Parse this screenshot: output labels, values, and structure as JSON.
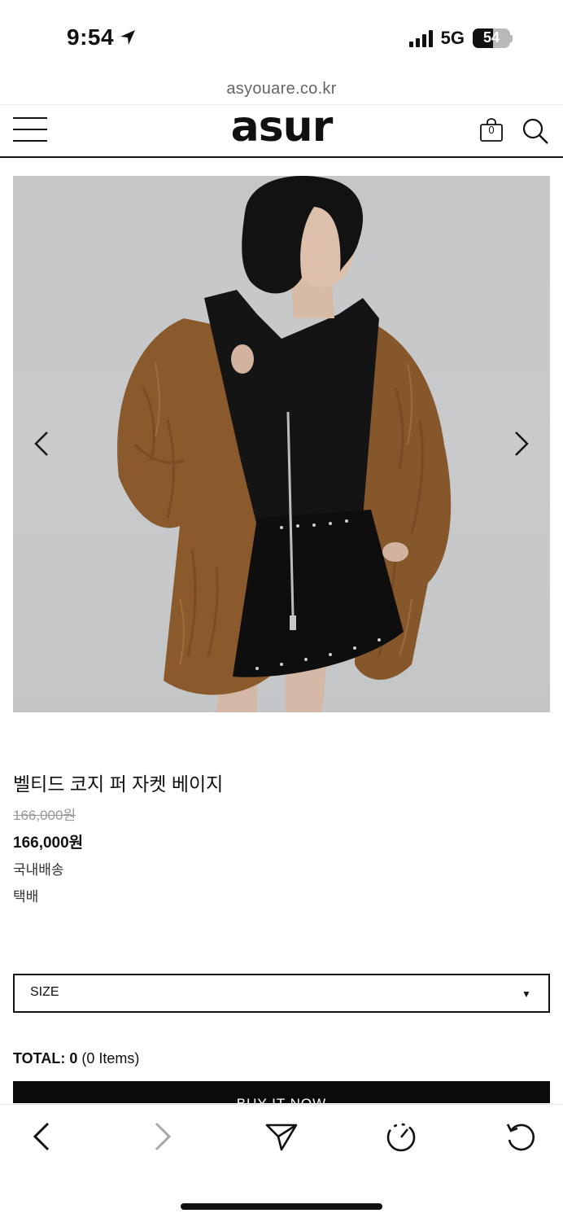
{
  "status_bar": {
    "time": "9:54",
    "network": "5G",
    "battery": "54",
    "battery_level": 0.54
  },
  "browser": {
    "url": "asyouare.co.kr"
  },
  "header": {
    "logo": "asur",
    "cart_count": "0",
    "icons": [
      "menu-icon",
      "shopping-bag-icon",
      "search-icon"
    ]
  },
  "gallery": {
    "prev_icon": "chevron-left-icon",
    "next_icon": "chevron-right-icon"
  },
  "product": {
    "title": "벨티드 코지 퍼 자켓 베이지",
    "original_price": "166,000원",
    "price": "166,000원",
    "shipping_region": "국내배송",
    "shipping_method": "택배"
  },
  "options": {
    "size_label": "SIZE"
  },
  "total": {
    "label": "TOTAL:",
    "amount": "0",
    "items": "(0 Items)"
  },
  "actions": {
    "buy_now": "BUY IT NOW"
  },
  "toolbar": {
    "icons": [
      "back-icon",
      "forward-icon",
      "share-icon",
      "speed-icon",
      "reload-icon"
    ]
  },
  "colors": {
    "text": "#111111",
    "muted": "#999999",
    "button": "#0b0b0b",
    "photo_bg": "#c7c8ca",
    "fur": "#8a5a2c"
  }
}
